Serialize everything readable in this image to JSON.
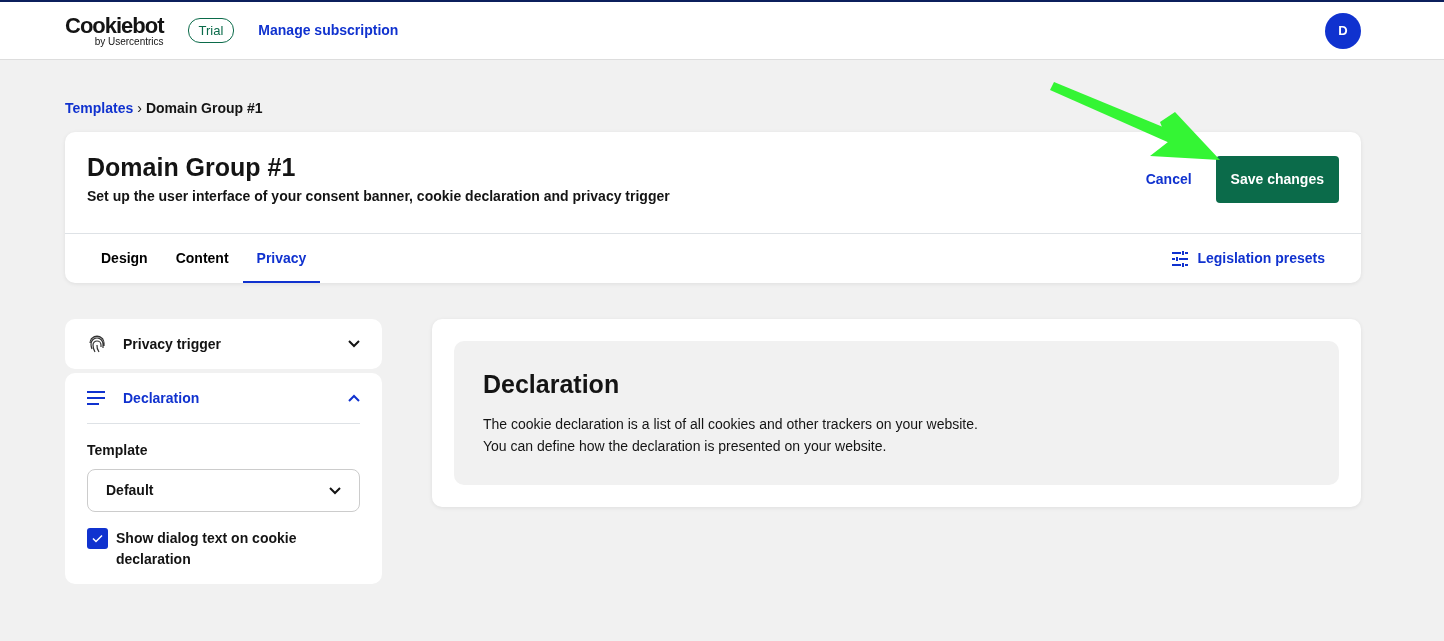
{
  "header": {
    "logo": "Cookiebot",
    "logo_sub": "by Usercentrics",
    "plan_badge": "Trial",
    "manage_link": "Manage subscription",
    "avatar": "D"
  },
  "breadcrumb": [
    {
      "label": "Templates",
      "kind": "link"
    },
    {
      "label": "›",
      "kind": "separator"
    },
    {
      "label": "Domain Group #1",
      "kind": "current"
    }
  ],
  "page": {
    "title": "Domain Group #1",
    "subtitle": "Set up the user interface of your consent banner, cookie declaration and privacy trigger",
    "cancel": "Cancel",
    "save": "Save changes"
  },
  "tabs": [
    {
      "label": "Design",
      "selected": false
    },
    {
      "label": "Content",
      "selected": false
    },
    {
      "label": "Privacy",
      "selected": true
    }
  ],
  "presets_link": "Legislation presets",
  "sections": [
    {
      "title": "Privacy trigger",
      "kind": "fingerprint",
      "expanded": false
    },
    {
      "title": "Declaration",
      "kind": "lines",
      "expanded": true,
      "field_label": "Template",
      "select_value": "Default",
      "checkbox": {
        "label": "Show dialog text on cookie declaration",
        "checked": true
      }
    }
  ],
  "info": {
    "title": "Declaration",
    "lines": [
      "The cookie declaration is a list of all cookies and other trackers on your website.",
      "You can define how the declaration is presented on your website."
    ]
  }
}
